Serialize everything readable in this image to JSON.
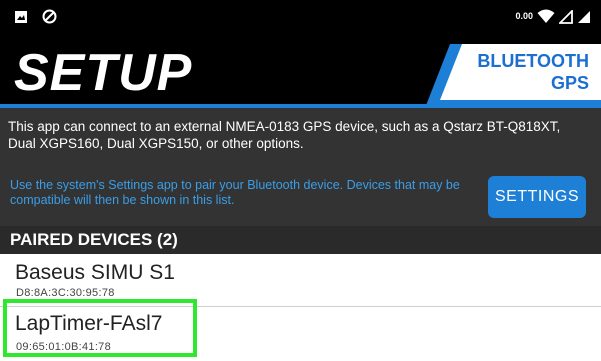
{
  "status_bar": {
    "icons": [
      "image-icon",
      "no-disturb-icon",
      "data-icon",
      "wifi-icon",
      "signal-icon",
      "signal-icon"
    ],
    "data_label": "0.00"
  },
  "header": {
    "title": "SETUP",
    "panel_label_line1": "BLUETOOTH",
    "panel_label_line2": "GPS"
  },
  "info": {
    "description": "This app can connect to an external NMEA-0183 GPS device, such as a Qstarz BT-Q818XT, Dual XGPS160, Dual XGPS150, or other options.",
    "hint": "Use the system's Settings app to pair your Bluetooth device. Devices that may be compatible will then be shown in this list.",
    "settings_button_label": "SETTINGS"
  },
  "paired_devices": {
    "title": "PAIRED DEVICES (2)",
    "devices": [
      {
        "name": "Baseus SIMU S1",
        "address": "D8:8A:3C:30:95:78"
      },
      {
        "name": "LapTimer-FAsl7",
        "address": "09:65:01:0B:41:78"
      }
    ]
  },
  "colors": {
    "accent_blue": "#1e7fd6",
    "highlight_green": "#2ee82e",
    "header_bg": "#000000",
    "info_bg": "#333333"
  }
}
